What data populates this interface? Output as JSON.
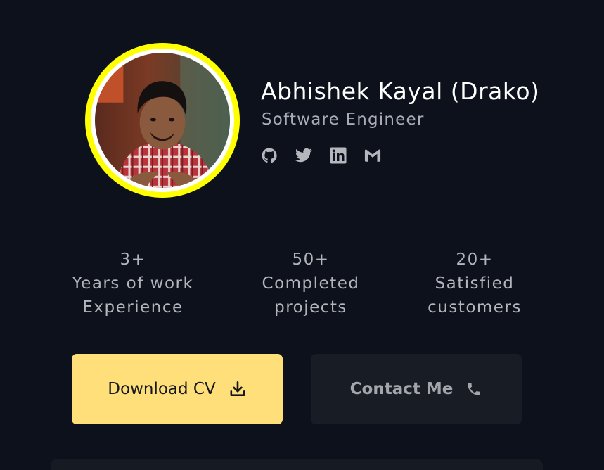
{
  "profile": {
    "name": "Abhishek Kayal (Drako)",
    "role": "Software Engineer",
    "avatar_alt": "profile photo"
  },
  "socials": [
    {
      "name": "github",
      "icon": "github-icon"
    },
    {
      "name": "twitter",
      "icon": "twitter-icon"
    },
    {
      "name": "linkedin",
      "icon": "linkedin-icon"
    },
    {
      "name": "gmail",
      "icon": "gmail-icon"
    }
  ],
  "stats": [
    {
      "value": "3+",
      "line1": "Years of work",
      "line2": "Experience"
    },
    {
      "value": "50+",
      "line1": "Completed",
      "line2": "projects"
    },
    {
      "value": "20+",
      "line1": "Satisfied",
      "line2": "customers"
    }
  ],
  "actions": {
    "download_cv": {
      "label": "Download CV",
      "icon": "download-icon"
    },
    "contact": {
      "label": "Contact Me",
      "icon": "phone-icon"
    }
  },
  "colors": {
    "background": "#0c111b",
    "accent_ring": "#ffff00",
    "primary_button": "#ffdf79",
    "secondary_button": "#181c24"
  }
}
